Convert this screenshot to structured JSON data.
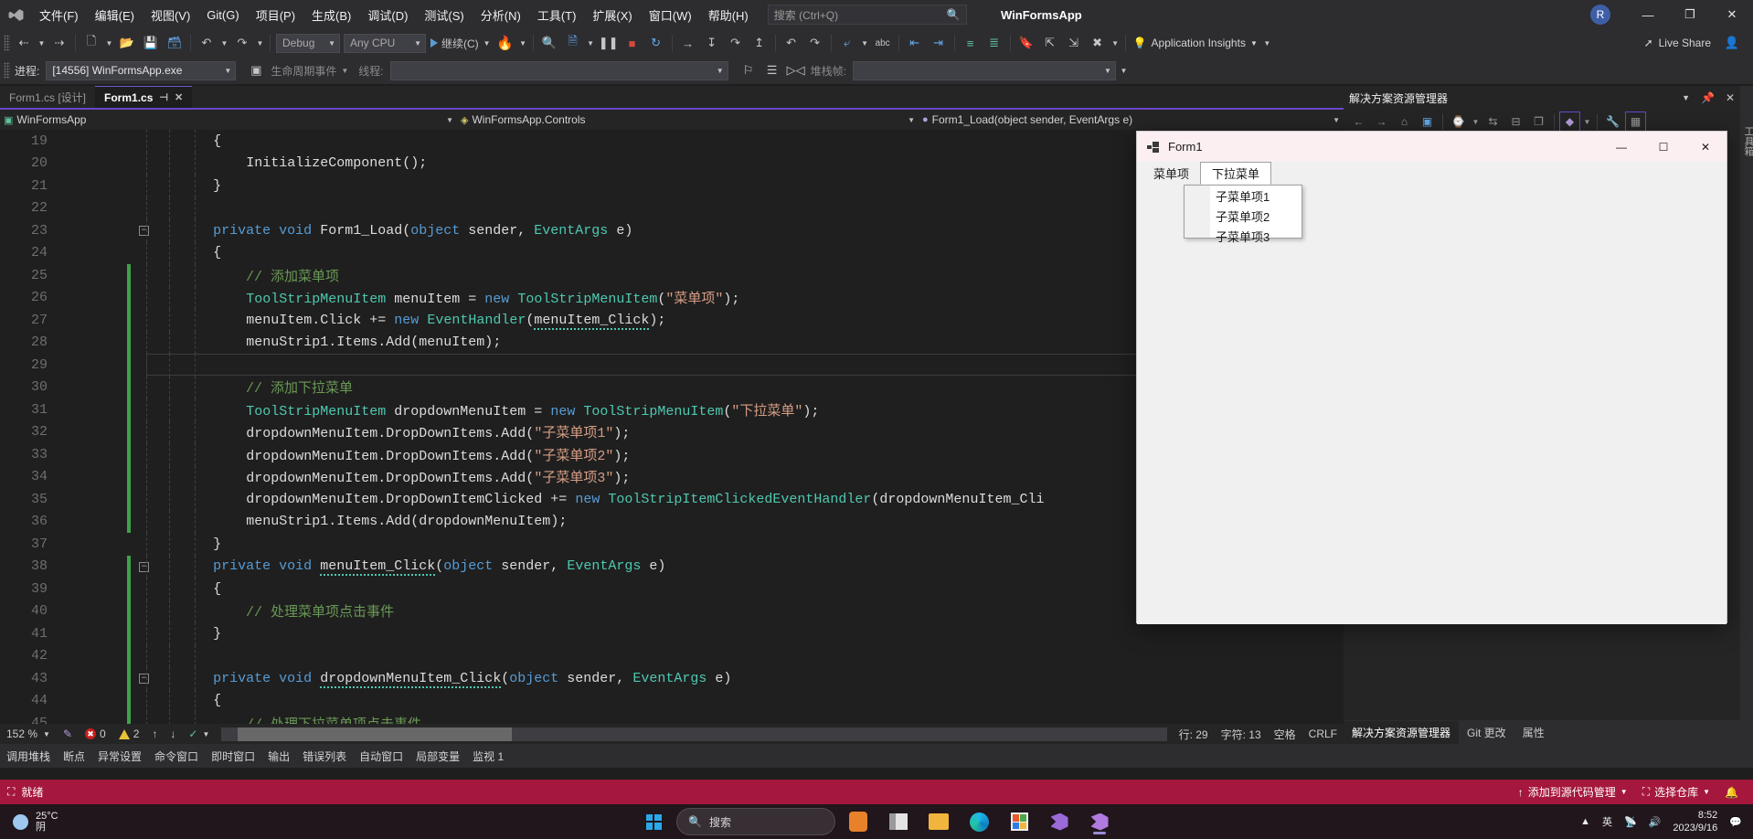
{
  "titlebar": {
    "menus": [
      "文件(F)",
      "编辑(E)",
      "视图(V)",
      "Git(G)",
      "项目(P)",
      "生成(B)",
      "调试(D)",
      "测试(S)",
      "分析(N)",
      "工具(T)",
      "扩展(X)",
      "窗口(W)",
      "帮助(H)"
    ],
    "search_placeholder": "搜索 (Ctrl+Q)",
    "app_title": "WinFormsApp",
    "account_initial": "R",
    "window_buttons": {
      "minimize": "—",
      "maximize": "❐",
      "close": "✕"
    }
  },
  "toolbar": {
    "config": "Debug",
    "platform": "Any CPU",
    "run_label": "继续(C)",
    "app_insights": "Application Insights",
    "live_share": "Live Share"
  },
  "debugbar": {
    "process_label": "进程:",
    "process_value": "[14556] WinFormsApp.exe",
    "lifecycle_label": "生命周期事件",
    "thread_label": "线程:",
    "thread_value": "",
    "stackframe_label": "堆栈帧:",
    "stackframe_value": ""
  },
  "tabs": [
    {
      "label": "Form1.cs [设计]",
      "active": false
    },
    {
      "label": "Form1.cs",
      "active": true,
      "pin": "⊣",
      "close": "✕"
    }
  ],
  "breadcrumb": {
    "project": "WinFormsApp",
    "class": "WinFormsApp.Controls",
    "member": "Form1_Load(object sender, EventArgs e)"
  },
  "code": {
    "lines": [
      {
        "n": "19",
        "change": false,
        "fold": "",
        "text": "        {"
      },
      {
        "n": "20",
        "change": false,
        "fold": "",
        "text": "            InitializeComponent();"
      },
      {
        "n": "21",
        "change": false,
        "fold": "",
        "text": "        }"
      },
      {
        "n": "22",
        "change": false,
        "fold": "",
        "text": ""
      },
      {
        "n": "23",
        "change": false,
        "fold": "−",
        "text": "        private void Form1_Load(object sender, EventArgs e)"
      },
      {
        "n": "24",
        "change": false,
        "fold": "",
        "text": "        {"
      },
      {
        "n": "25",
        "change": true,
        "fold": "",
        "text": "            // 添加菜单项"
      },
      {
        "n": "26",
        "change": true,
        "fold": "",
        "text": "            ToolStripMenuItem menuItem = new ToolStripMenuItem(\"菜单项\");"
      },
      {
        "n": "27",
        "change": true,
        "fold": "",
        "text": "            menuItem.Click += new EventHandler(menuItem_Click);"
      },
      {
        "n": "28",
        "change": true,
        "fold": "",
        "text": "            menuStrip1.Items.Add(menuItem);"
      },
      {
        "n": "29",
        "change": true,
        "fold": "",
        "text": ""
      },
      {
        "n": "30",
        "change": true,
        "fold": "",
        "text": "            // 添加下拉菜单"
      },
      {
        "n": "31",
        "change": true,
        "fold": "",
        "text": "            ToolStripMenuItem dropdownMenuItem = new ToolStripMenuItem(\"下拉菜单\");"
      },
      {
        "n": "32",
        "change": true,
        "fold": "",
        "text": "            dropdownMenuItem.DropDownItems.Add(\"子菜单项1\");"
      },
      {
        "n": "33",
        "change": true,
        "fold": "",
        "text": "            dropdownMenuItem.DropDownItems.Add(\"子菜单项2\");"
      },
      {
        "n": "34",
        "change": true,
        "fold": "",
        "text": "            dropdownMenuItem.DropDownItems.Add(\"子菜单项3\");"
      },
      {
        "n": "35",
        "change": true,
        "fold": "",
        "text": "            dropdownMenuItem.DropDownItemClicked += new ToolStripItemClickedEventHandler(dropdownMenuItem_Cli"
      },
      {
        "n": "36",
        "change": true,
        "fold": "",
        "text": "            menuStrip1.Items.Add(dropdownMenuItem);"
      },
      {
        "n": "37",
        "change": false,
        "fold": "",
        "text": "        }"
      },
      {
        "n": "38",
        "change": true,
        "fold": "−",
        "text": "        private void menuItem_Click(object sender, EventArgs e)"
      },
      {
        "n": "39",
        "change": true,
        "fold": "",
        "text": "        {"
      },
      {
        "n": "40",
        "change": true,
        "fold": "",
        "text": "            // 处理菜单项点击事件"
      },
      {
        "n": "41",
        "change": true,
        "fold": "",
        "text": "        }"
      },
      {
        "n": "42",
        "change": true,
        "fold": "",
        "text": ""
      },
      {
        "n": "43",
        "change": true,
        "fold": "−",
        "text": "        private void dropdownMenuItem_Click(object sender, EventArgs e)"
      },
      {
        "n": "44",
        "change": true,
        "fold": "",
        "text": "        {"
      },
      {
        "n": "45",
        "change": true,
        "fold": "",
        "text": "            // 处理下拉菜单项点击事件"
      }
    ],
    "current_line": "29"
  },
  "editor_status": {
    "zoom": "152 %",
    "errors": "0",
    "warnings": "2",
    "line_label": "行: 29",
    "char_label": "字符: 13",
    "spaces": "空格",
    "eol": "CRLF"
  },
  "dock_tabs": [
    "调用堆栈",
    "断点",
    "异常设置",
    "命令窗口",
    "即时窗口",
    "输出",
    "错误列表",
    "自动窗口",
    "局部变量",
    "监视 1"
  ],
  "solution_explorer": {
    "title": "解决方案资源管理器",
    "footer_tabs": [
      {
        "label": "解决方案资源管理器",
        "active": true
      },
      {
        "label": "Git 更改",
        "active": false
      },
      {
        "label": "属性",
        "active": false
      }
    ],
    "rail_text": "工具箱"
  },
  "vs_status": {
    "ready": "就绪",
    "source_control": "添加到源代码管理",
    "repo": "选择仓库",
    "bell": "🔔"
  },
  "form1": {
    "title": "Form1",
    "window_buttons": {
      "minimize": "—",
      "maximize": "☐",
      "close": "✕"
    },
    "menus": [
      {
        "label": "菜单项",
        "open": false
      },
      {
        "label": "下拉菜单",
        "open": true
      }
    ],
    "dropdown_items": [
      "子菜单项1",
      "子菜单项2",
      "子菜单项3"
    ]
  },
  "taskbar": {
    "weather_temp": "25°C",
    "weather_cond": "阴",
    "search_placeholder": "搜索",
    "ime": "英",
    "clock_time": "8:52",
    "clock_date": "2023/9/16"
  },
  "colors": {
    "accent_purple": "#6a46c8",
    "status_red": "#a5173c",
    "change_green": "#3fa14a",
    "keyword_blue": "#569cd6",
    "type_teal": "#4ec9b0",
    "string_orange": "#d69d85",
    "comment_green": "#6a9955"
  }
}
